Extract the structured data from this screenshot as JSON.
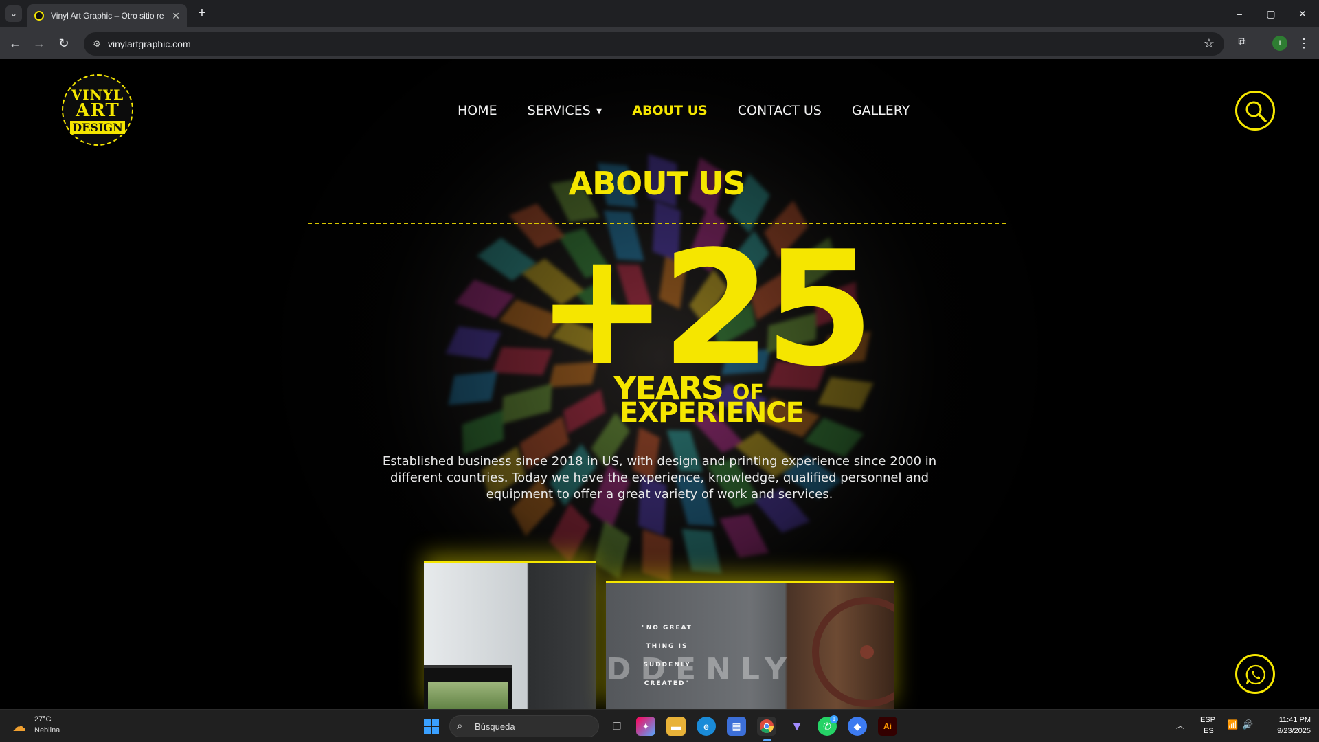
{
  "browser": {
    "tab_title": "Vinyl Art Graphic – Otro sitio re",
    "url": "vinylartgraphic.com",
    "new_tab": "+",
    "minimize": "–",
    "restore": "▢",
    "close": "✕",
    "profile_initial": "I"
  },
  "site": {
    "logo": {
      "line1": "VINYL",
      "line2": "ART",
      "line3": "DESIGN"
    },
    "nav": [
      {
        "label": "HOME"
      },
      {
        "label": "SERVICES"
      },
      {
        "label": "ABOUT US"
      },
      {
        "label": "CONTACT US"
      },
      {
        "label": "GALLERY"
      }
    ],
    "active_nav": "ABOUT US",
    "accent_color": "#f5e600",
    "heading": "ABOUT US",
    "big_number": "+25",
    "years_word": "YEARS",
    "of_word": "OF",
    "experience_word": "EXPERIENCE",
    "description": "Established business since 2018 in US, with design and printing experience since 2000 in different countries. Today we have the experience, knowledge, qualified personnel and equipment to offer a great variety of work and services.",
    "photo_quote": "\"NO GREAT THING IS SUDDENLY CREATED\"",
    "photo_ghost_text": "DDENLY"
  },
  "taskbar": {
    "weather_temp": "27°C",
    "weather_desc": "Neblina",
    "search_placeholder": "Búsqueda",
    "whatsapp_badge": "1",
    "lang_top": "ESP",
    "lang_bottom": "ES",
    "time": "11:41 PM",
    "date": "9/23/2025"
  }
}
